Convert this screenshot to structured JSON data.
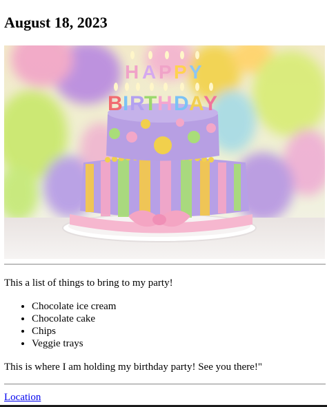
{
  "page": {
    "date_heading": "August 18, 2023",
    "intro_text": "This a list of things to bring to my party!",
    "items": [
      "Chocolate ice cream",
      "Chocolate cake",
      "Chips",
      "Veggie trays"
    ],
    "outro_text": "This is where I am holding my birthday party! See you there!\"",
    "location_link": "Location"
  },
  "image": {
    "subject": "birthday cake with candles and balloons",
    "candle_text_top": "HAPPY",
    "candle_text_bottom": "BIRTHDAY",
    "colors": {
      "lilac": "#b59ae0",
      "yellow": "#f3d24a",
      "pink": "#f6b7cf",
      "green": "#9fdc7a",
      "board": "#f7f3f4"
    }
  }
}
